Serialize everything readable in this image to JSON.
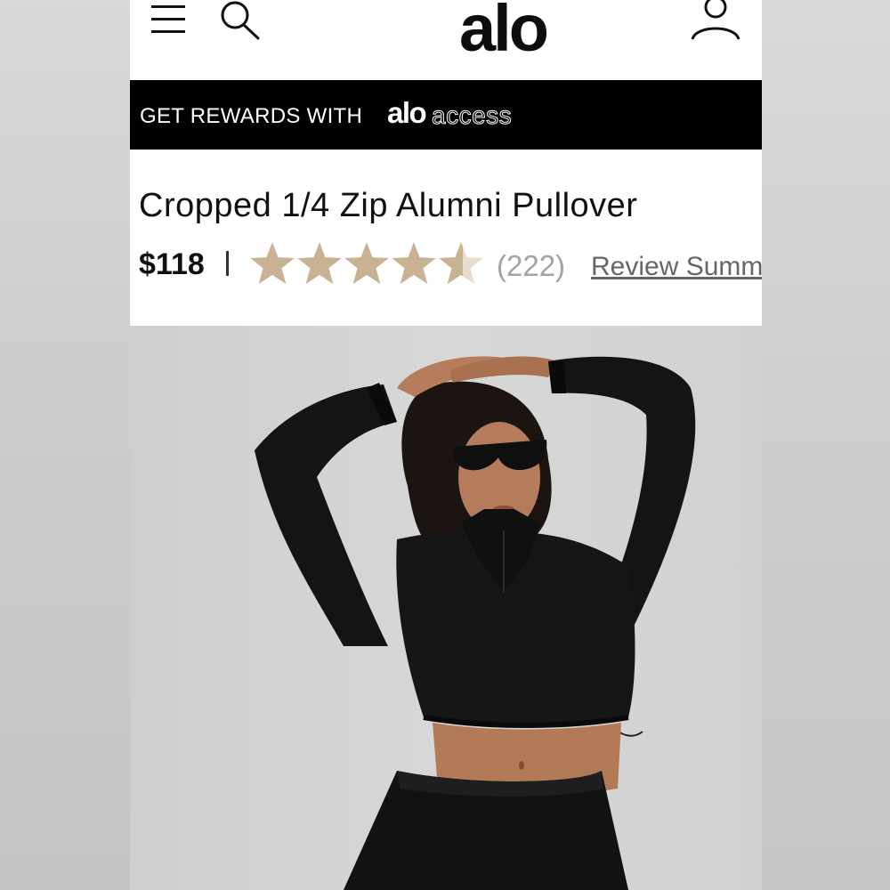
{
  "header": {
    "logo_text": "alo",
    "menu_icon": "hamburger-menu-icon",
    "search_icon": "search-icon",
    "account_icon": "account-icon"
  },
  "promo": {
    "text": "GET REWARDS WITH",
    "brand": "alo",
    "brand_suffix": "access"
  },
  "product": {
    "title": "Cropped 1/4 Zip Alumni Pullover",
    "price": "$118",
    "separator": "|",
    "rating": 4.5,
    "rating_max": 5,
    "review_count": "(222)",
    "review_link": "Review Summ",
    "image_alt": "Model wearing black cropped quarter-zip pullover and sunglasses with arms raised"
  },
  "colors": {
    "star_fill": "#c9b193",
    "promo_bg": "#000000",
    "count_text": "#a3a3a3",
    "link_text": "#666666"
  }
}
